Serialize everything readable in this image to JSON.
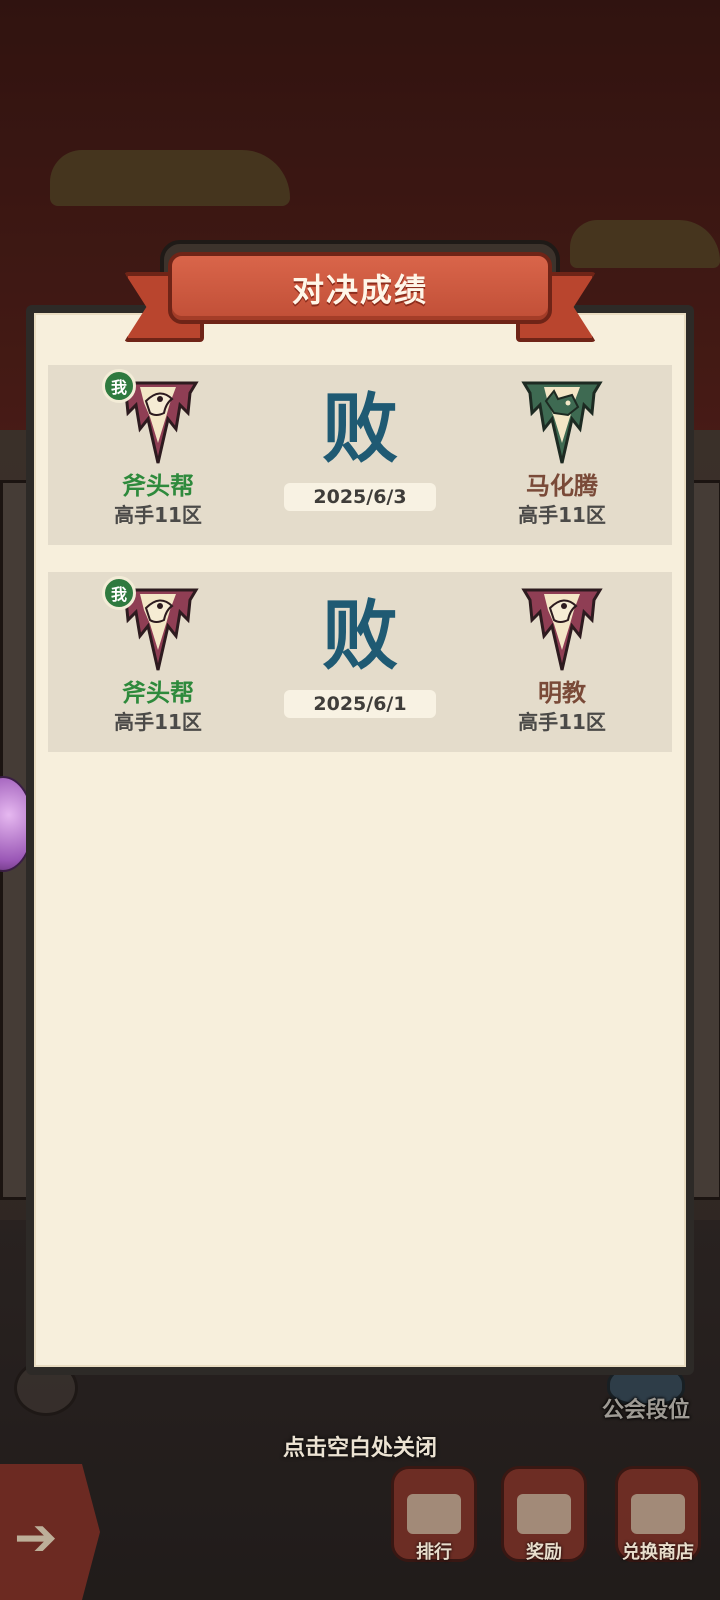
{
  "panel": {
    "title": "对决成绩"
  },
  "matches": [
    {
      "me_badge": "我",
      "left": {
        "name": "斧头帮",
        "server": "高手11区",
        "emblem": "bird-emblem-icon",
        "emblem_color": "#8f3e54"
      },
      "result": "败",
      "date": "2025/6/3",
      "right": {
        "name": "马化腾",
        "server": "高手11区",
        "emblem": "rhino-emblem-icon",
        "emblem_color": "#3e6a52"
      }
    },
    {
      "me_badge": "我",
      "left": {
        "name": "斧头帮",
        "server": "高手11区",
        "emblem": "bird-emblem-icon",
        "emblem_color": "#8f3e54"
      },
      "result": "败",
      "date": "2025/6/1",
      "right": {
        "name": "明教",
        "server": "高手11区",
        "emblem": "bird-emblem-icon",
        "emblem_color": "#8f3e54"
      }
    }
  ],
  "hint": {
    "close": "点击空白处关闭"
  },
  "background": {
    "guild_rank_label": "公会段位"
  },
  "bottom_bar": {
    "rank_label": "排行",
    "reward_label": "奖励",
    "shop_label": "兑换商店"
  },
  "colors": {
    "mine_name": "#2e8a3c",
    "enemy_name": "#7a4a38",
    "result": "#1f5a73",
    "ribbon": "#c14f37"
  }
}
